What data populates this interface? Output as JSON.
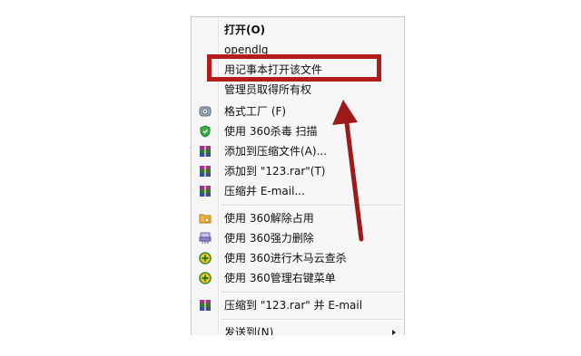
{
  "context_menu": {
    "items": [
      {
        "label": "打开(O)",
        "bold": true,
        "icon": ""
      },
      {
        "label": "opendlg",
        "icon": ""
      },
      {
        "label": "用记事本打开该文件",
        "icon": ""
      },
      {
        "label": "管理员取得所有权",
        "icon": ""
      },
      {
        "label": "格式工厂 (F)",
        "icon": "format-factory-icon"
      },
      {
        "label": "使用 360杀毒 扫描",
        "icon": "360-antivirus-shield-icon"
      },
      {
        "label": "添加到压缩文件(A)...",
        "icon": "winrar-books-icon"
      },
      {
        "label": "添加到 \"123.rar\"(T)",
        "icon": "winrar-books-icon"
      },
      {
        "label": "压缩并 E-mail...",
        "icon": "winrar-books-icon"
      },
      {
        "label": "使用 360解除占用",
        "icon": "360-unlock-folder-icon"
      },
      {
        "label": "使用 360强力删除",
        "icon": "360-shredder-icon"
      },
      {
        "label": "使用 360进行木马云查杀",
        "icon": "360-guard-plus-icon"
      },
      {
        "label": "使用 360管理右键菜单",
        "icon": "360-guard-plus-icon"
      },
      {
        "label": "压缩到 \"123.rar\" 并 E-mail",
        "icon": "winrar-books-icon"
      },
      {
        "label": "发送到(N)",
        "icon": "",
        "submenu": true
      }
    ]
  },
  "annotation": {
    "highlight_color": "#b41c1c",
    "arrow_color": "#9e1a1a"
  }
}
